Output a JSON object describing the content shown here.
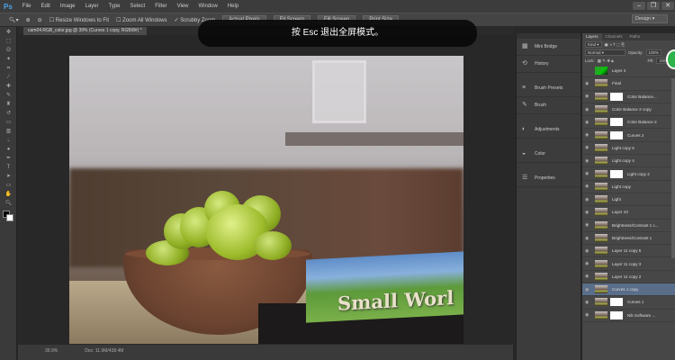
{
  "menu": {
    "logo": "Ps",
    "items": [
      "File",
      "Edit",
      "Image",
      "Layer",
      "Type",
      "Select",
      "Filter",
      "View",
      "Window",
      "Help"
    ]
  },
  "options": {
    "resize_windows": "Resize Windows to Fit",
    "zoom_all": "Zoom All Windows",
    "scrubby_zoom": "Scrubby Zoom",
    "buttons": [
      "Actual Pixels",
      "Fit Screen",
      "Fill Screen",
      "Print Size"
    ]
  },
  "workspace": "Design",
  "document_tab": "cam04.RGB_color.jpg @ 39% (Curves 1 copy, RGB/8#) *",
  "toast": "按 Esc 退出全屏模式。",
  "status": {
    "zoom": "39.9%",
    "doc": "Doc: 11.9M/438.4M"
  },
  "photo": {
    "book_text": "Small Worl"
  },
  "dock": [
    {
      "icon": "mini-bridge-icon",
      "glyph": "▦",
      "label": "Mini Bridge"
    },
    {
      "icon": "history-icon",
      "glyph": "⟲",
      "label": "History"
    },
    {
      "icon": "brush-presets-icon",
      "glyph": "≡",
      "label": "Brush Presets"
    },
    {
      "icon": "brush-icon",
      "glyph": "✎",
      "label": "Brush"
    },
    {
      "icon": "adjustments-icon",
      "glyph": "◐",
      "label": "Adjustments"
    },
    {
      "icon": "color-icon",
      "glyph": "◒",
      "label": "Color"
    },
    {
      "icon": "properties-icon",
      "glyph": "☰",
      "label": "Properties"
    }
  ],
  "layers_panel": {
    "tabs": [
      "Layers",
      "Channels",
      "Paths"
    ],
    "kind": "Kind",
    "blend": "Normal",
    "opacity_label": "Opacity:",
    "opacity": "100%",
    "lock_label": "Lock:",
    "fill_label": "Fill:",
    "fill": "100%",
    "layers": [
      {
        "name": "Layer 4",
        "mask": false,
        "selected": false
      },
      {
        "name": "Final",
        "mask": false,
        "selected": false
      },
      {
        "name": "Color Balance...",
        "mask": true,
        "selected": false
      },
      {
        "name": "Color Balance 2 copy",
        "mask": false,
        "selected": false
      },
      {
        "name": "Color Balance 2",
        "mask": true,
        "selected": false
      },
      {
        "name": "Curves 2",
        "mask": true,
        "selected": false
      },
      {
        "name": "Light copy 5",
        "mask": false,
        "selected": false
      },
      {
        "name": "Light copy 4",
        "mask": false,
        "selected": false
      },
      {
        "name": "Light copy 2",
        "mask": true,
        "selected": false
      },
      {
        "name": "Light copy",
        "mask": false,
        "selected": false
      },
      {
        "name": "Light",
        "mask": false,
        "selected": false
      },
      {
        "name": "Layer 10",
        "mask": false,
        "selected": false
      },
      {
        "name": "Brightness/Contrast 1 c...",
        "mask": false,
        "selected": false
      },
      {
        "name": "Brightness/Contrast 1",
        "mask": false,
        "selected": false
      },
      {
        "name": "Layer 11 copy 5",
        "mask": false,
        "selected": false
      },
      {
        "name": "Layer 11 copy 3",
        "mask": false,
        "selected": false
      },
      {
        "name": "Layer 11 copy 2",
        "mask": false,
        "selected": false
      },
      {
        "name": "Curves 1 copy",
        "mask": false,
        "selected": true
      },
      {
        "name": "Curves 1",
        "mask": true,
        "selected": false
      },
      {
        "name": "Nik Software ...",
        "mask": true,
        "selected": false
      }
    ]
  }
}
